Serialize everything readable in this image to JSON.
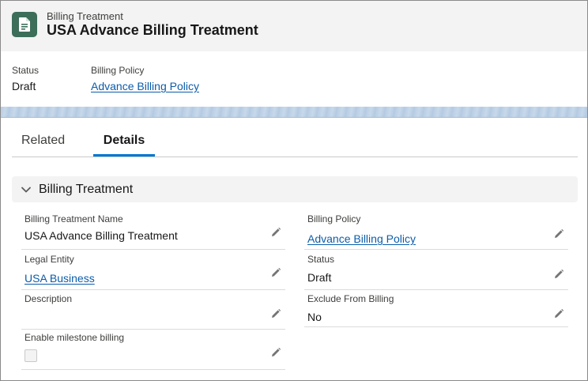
{
  "header": {
    "object_type": "Billing Treatment",
    "title": "USA Advance Billing Treatment",
    "icon": "document-icon",
    "icon_color": "#3c6e5a"
  },
  "highlights": {
    "status_label": "Status",
    "status_value": "Draft",
    "policy_label": "Billing Policy",
    "policy_value": "Advance Billing Policy"
  },
  "tabs": [
    {
      "label": "Related",
      "active": false
    },
    {
      "label": "Details",
      "active": true
    }
  ],
  "section": {
    "title": "Billing Treatment",
    "expanded": true
  },
  "fields": {
    "name": {
      "label": "Billing Treatment Name",
      "value": "USA Advance Billing Treatment"
    },
    "billing_policy": {
      "label": "Billing Policy",
      "value": "Advance Billing Policy"
    },
    "legal_entity": {
      "label": "Legal Entity",
      "value": "USA Business"
    },
    "status": {
      "label": "Status",
      "value": "Draft"
    },
    "description": {
      "label": "Description",
      "value": ""
    },
    "exclude_from_billing": {
      "label": "Exclude From Billing",
      "value": "No"
    },
    "milestone_billing": {
      "label": "Enable milestone billing",
      "checked": false
    }
  },
  "colors": {
    "link": "#0b5cab",
    "tab_active": "#0176d3"
  }
}
